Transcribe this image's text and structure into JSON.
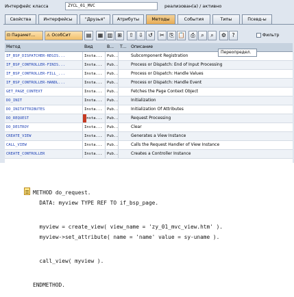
{
  "header": {
    "class_label": "Интерфейс класса",
    "class_value": "ZYCL_01_MVC",
    "status": "реализован(а) / активно"
  },
  "tabs": [
    {
      "label": "Свойства",
      "active": false
    },
    {
      "label": "Интерфейсы",
      "active": false
    },
    {
      "label": "\"Друзья\"",
      "active": false
    },
    {
      "label": "Атрибуты",
      "active": false
    },
    {
      "label": "Методы",
      "active": true
    },
    {
      "label": "События",
      "active": false
    },
    {
      "label": "Типы",
      "active": false
    },
    {
      "label": "Псевд-ы",
      "active": false
    }
  ],
  "toolbar": {
    "param_label": "Парамет...",
    "exc_label": "ОсобСит",
    "filter_label": "Фильтр"
  },
  "table": {
    "columns": [
      "Метод",
      "Вид",
      "В...",
      "Т...",
      "Описание"
    ],
    "rows": [
      [
        "IF_BSP_DISPATCHER-REGIS...",
        "Insta...",
        "Pub...",
        "",
        "Subcomponent Registration"
      ],
      [
        "IF_BSP_CONTROLLER-FINIS...",
        "Insta...",
        "Pub...",
        "",
        "Process or Dispatch: End of Input Processing"
      ],
      [
        "IF_BSP_CONTROLLER-FILL_...",
        "Insta...",
        "Pub...",
        "",
        "Process or Dispatch: Handle Values"
      ],
      [
        "IF_BSP_CONTROLLER-HANDL...",
        "Insta...",
        "Pub...",
        "",
        "Process or Dispatch: Handle Event"
      ],
      [
        "GET_PAGE_CONTEXT",
        "Insta...",
        "Pub...",
        "",
        "Fetches the Page Context Object"
      ],
      [
        "DO_INIT",
        "Insta...",
        "Pub...",
        "",
        "Initialization"
      ],
      [
        "DO_INITATTRIBUTES",
        "Insta...",
        "Pub...",
        "",
        "Initialization Of Attributes"
      ],
      [
        "DO_REQUEST",
        "Insta...",
        "Pub...",
        "",
        "Request Processing"
      ],
      [
        "DO_DESTROY",
        "Insta...",
        "Pub...",
        "",
        "Clear"
      ],
      [
        "CREATE_VIEW",
        "Insta...",
        "Pub...",
        "",
        "Generates a View Instance"
      ],
      [
        "CALL_VIEW",
        "Insta...",
        "Pub...",
        "",
        "Calls the Request Handler of View Instance"
      ],
      [
        "CREATE_CONTROLLER",
        "Insta...",
        "Pub...",
        "",
        "Creates a Controller Instance"
      ]
    ],
    "selected_row": 7,
    "tooltip": "Переопредел."
  },
  "code": {
    "lines": [
      "METHOD do_request.",
      "  DATA: myview TYPE REF TO if_bsp_page.",
      "",
      "  myview = create_view( view_name = 'zy_01_mvc_view.htm' ).",
      "  myview->set_attribute( name = 'name' value = sy-uname ).",
      "",
      "  call_view( myview ).",
      "",
      "ENDMETHOD."
    ]
  }
}
